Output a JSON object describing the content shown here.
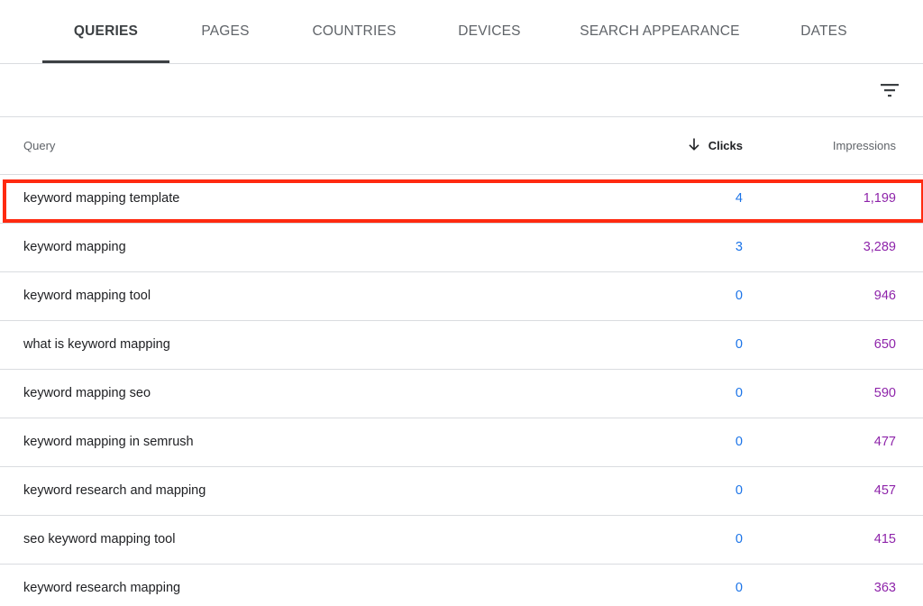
{
  "tabs": [
    {
      "label": "QUERIES",
      "active": true
    },
    {
      "label": "PAGES",
      "active": false
    },
    {
      "label": "COUNTRIES",
      "active": false
    },
    {
      "label": "DEVICES",
      "active": false
    },
    {
      "label": "SEARCH APPEARANCE",
      "active": false
    },
    {
      "label": "DATES",
      "active": false
    }
  ],
  "toolbar": {
    "filter_icon": "filter-list-icon"
  },
  "table": {
    "headers": {
      "query": "Query",
      "clicks": "Clicks",
      "impressions": "Impressions",
      "sort_icon": "arrow-down-icon"
    },
    "rows": [
      {
        "query": "keyword mapping template",
        "clicks": "4",
        "impressions": "1,199"
      },
      {
        "query": "keyword mapping",
        "clicks": "3",
        "impressions": "3,289"
      },
      {
        "query": "keyword mapping tool",
        "clicks": "0",
        "impressions": "946"
      },
      {
        "query": "what is keyword mapping",
        "clicks": "0",
        "impressions": "650"
      },
      {
        "query": "keyword mapping seo",
        "clicks": "0",
        "impressions": "590"
      },
      {
        "query": "keyword mapping in semrush",
        "clicks": "0",
        "impressions": "477"
      },
      {
        "query": "keyword research and mapping",
        "clicks": "0",
        "impressions": "457"
      },
      {
        "query": "seo keyword mapping tool",
        "clicks": "0",
        "impressions": "415"
      },
      {
        "query": "keyword research mapping",
        "clicks": "0",
        "impressions": "363"
      }
    ]
  },
  "colors": {
    "clicks": "#1a73e8",
    "impressions": "#8e24aa",
    "highlight": "#ff2a10"
  }
}
